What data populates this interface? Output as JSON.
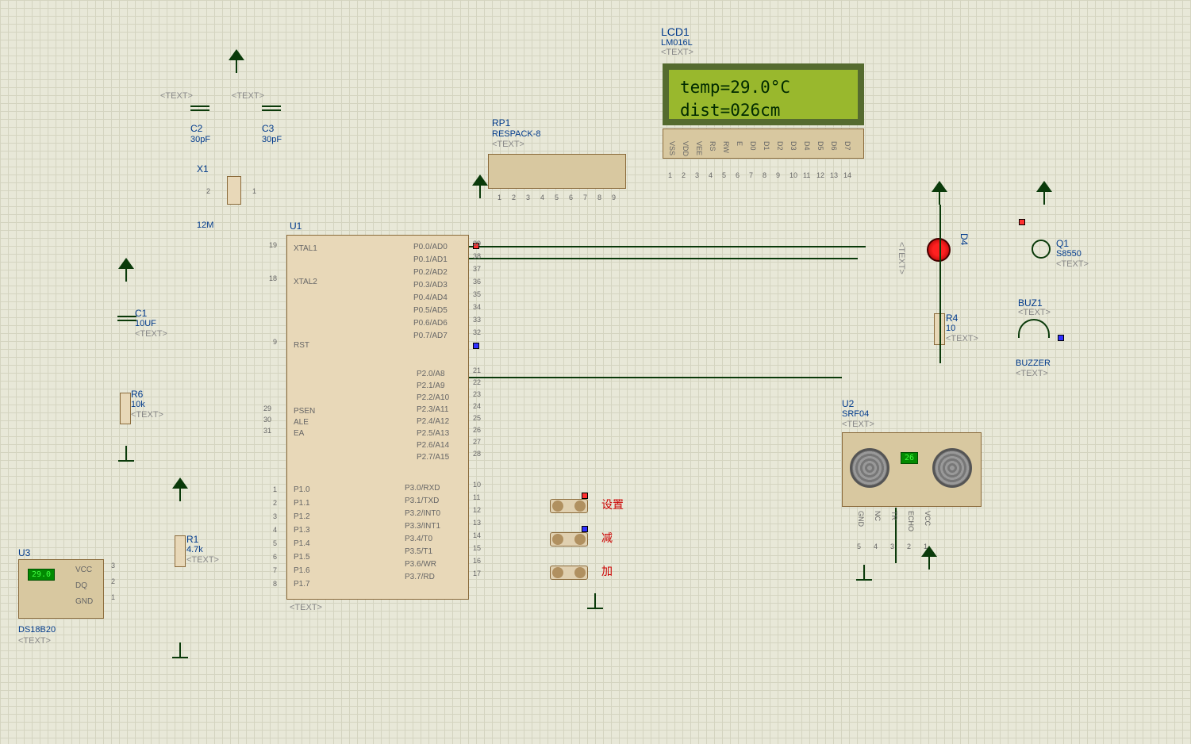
{
  "lcd": {
    "ref": "LCD1",
    "part": "LM016L",
    "text": "<TEXT>",
    "line1": "temp=29.0°C",
    "line2": "dist=026cm",
    "pins": [
      "VSS",
      "VDD",
      "VEE",
      "RS",
      "RW",
      "E",
      "D0",
      "D1",
      "D2",
      "D3",
      "D4",
      "D5",
      "D6",
      "D7"
    ],
    "pinNums": [
      "1",
      "2",
      "3",
      "4",
      "5",
      "6",
      "7",
      "8",
      "9",
      "10",
      "11",
      "12",
      "13",
      "14"
    ]
  },
  "mcu": {
    "ref": "U1",
    "text": "<TEXT>",
    "leftTop": [
      {
        "n": "19",
        "l": "XTAL1"
      },
      {
        "n": "18",
        "l": "XTAL2"
      },
      {
        "n": "9",
        "l": "RST"
      }
    ],
    "leftMid": [
      {
        "n": "29",
        "l": "PSEN"
      },
      {
        "n": "30",
        "l": "ALE"
      },
      {
        "n": "31",
        "l": "EA"
      }
    ],
    "leftBot": [
      [
        "1",
        "P1.0"
      ],
      [
        "2",
        "P1.1"
      ],
      [
        "3",
        "P1.2"
      ],
      [
        "4",
        "P1.3"
      ],
      [
        "5",
        "P1.4"
      ],
      [
        "6",
        "P1.5"
      ],
      [
        "7",
        "P1.6"
      ],
      [
        "8",
        "P1.7"
      ]
    ],
    "rightTop": [
      [
        "P0.0/AD0",
        "39"
      ],
      [
        "P0.1/AD1",
        "38"
      ],
      [
        "P0.2/AD2",
        "37"
      ],
      [
        "P0.3/AD3",
        "36"
      ],
      [
        "P0.4/AD4",
        "35"
      ],
      [
        "P0.5/AD5",
        "34"
      ],
      [
        "P0.6/AD6",
        "33"
      ],
      [
        "P0.7/AD7",
        "32"
      ]
    ],
    "rightMid": [
      [
        "P2.0/A8",
        "21"
      ],
      [
        "P2.1/A9",
        "22"
      ],
      [
        "P2.2/A10",
        "23"
      ],
      [
        "P2.3/A11",
        "24"
      ],
      [
        "P2.4/A12",
        "25"
      ],
      [
        "P2.5/A13",
        "26"
      ],
      [
        "P2.6/A14",
        "27"
      ],
      [
        "P2.7/A15",
        "28"
      ]
    ],
    "rightBot": [
      [
        "P3.0/RXD",
        "10"
      ],
      [
        "P3.1/TXD",
        "11"
      ],
      [
        "P3.2/INT0",
        "12"
      ],
      [
        "P3.3/INT1",
        "13"
      ],
      [
        "P3.4/T0",
        "14"
      ],
      [
        "P3.5/T1",
        "15"
      ],
      [
        "P3.6/WR",
        "16"
      ],
      [
        "P3.7/RD",
        "17"
      ]
    ]
  },
  "respack": {
    "ref": "RP1",
    "part": "RESPACK-8",
    "text": "<TEXT>",
    "pins": [
      "1",
      "2",
      "3",
      "4",
      "5",
      "6",
      "7",
      "8",
      "9"
    ]
  },
  "caps": {
    "c1": {
      "ref": "C1",
      "val": "10UF",
      "text": "<TEXT>"
    },
    "c2": {
      "ref": "C2",
      "val": "30pF",
      "text": "<TEXT>"
    },
    "c3": {
      "ref": "C3",
      "val": "30pF",
      "text": "<TEXT>"
    }
  },
  "res": {
    "r1": {
      "ref": "R1",
      "val": "4.7k",
      "text": "<TEXT>"
    },
    "r4": {
      "ref": "R4",
      "val": "10",
      "text": "<TEXT>"
    },
    "r6": {
      "ref": "R6",
      "val": "10k",
      "text": "<TEXT>"
    }
  },
  "xtal": {
    "ref": "X1",
    "val": "12M",
    "pins": [
      "2",
      "1"
    ]
  },
  "diode": {
    "ref": "D4",
    "text": "<TEXT>"
  },
  "trans": {
    "ref": "Q1",
    "part": "S8550",
    "text": "<TEXT>"
  },
  "buzzer": {
    "ref": "BUZ1",
    "text": "<TEXT>",
    "lbl": "BUZZER",
    "text2": "<TEXT>"
  },
  "srf": {
    "ref": "U2",
    "part": "SRF04",
    "text": "<TEXT>",
    "disp": "26",
    "pins": [
      "GND",
      "NC",
      "TR",
      "ECHO",
      "VCC"
    ],
    "pinNums": [
      "5",
      "4",
      "3",
      "2",
      "1"
    ]
  },
  "ds18": {
    "ref": "U3",
    "part": "DS18B20",
    "text": "<TEXT>",
    "disp": "29.0",
    "pins": [
      "VCC",
      "DQ",
      "GND"
    ],
    "pinNums": [
      "3",
      "2",
      "1"
    ]
  },
  "buttons": {
    "b1": "设置",
    "b2": "减",
    "b3": "加"
  }
}
